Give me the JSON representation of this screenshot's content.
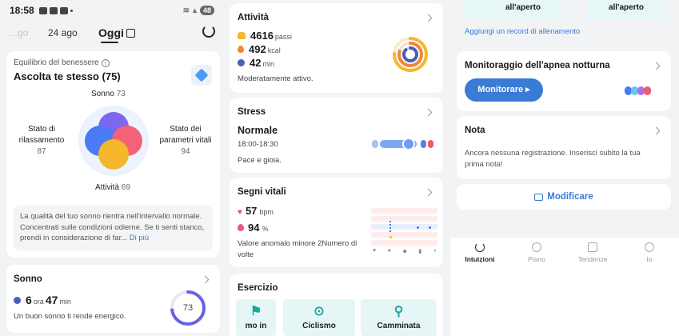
{
  "status_bar": {
    "time": "18:58",
    "battery": "48"
  },
  "date_nav": {
    "prev": "...go",
    "mid": "24 ago",
    "today": "Oggi"
  },
  "wellbeing": {
    "subtitle": "Equilibrio del benessere",
    "title": "Ascolta te stesso (75)",
    "sleep": {
      "label": "Sonno",
      "value": "73"
    },
    "relax": {
      "label": "Stato di rilassamento",
      "value": "87"
    },
    "vital": {
      "label": "Stato dei parametri vitali",
      "value": "94"
    },
    "activity": {
      "label": "Attività",
      "value": "69"
    },
    "advice": "La qualità del tuo sonno rientra nell'intervallo normale. Concentrati sulle condizioni odierne. Se ti senti stanco, prendi in considerazione di far...",
    "more_link": "Di più",
    "colors": {
      "sleep": "#7b68ee",
      "relax": "#4a7af4",
      "vital": "#f46277",
      "activity": "#f5b72c"
    }
  },
  "sleep_card": {
    "title": "Sonno",
    "hours": "6",
    "hours_unit": "ora",
    "minutes": "47",
    "minutes_unit": "min",
    "message": "Un buon sonno ti rende energico.",
    "score": "73",
    "score_fraction": 0.73
  },
  "activity_card": {
    "title": "Attività",
    "steps": "4616",
    "steps_unit": "passi",
    "kcal": "492",
    "kcal_unit": "kcal",
    "minutes": "42",
    "minutes_unit": "min",
    "status": "Moderatamente attivo."
  },
  "stress_card": {
    "title": "Stress",
    "value": "Normale",
    "time_range": "18:00-18:30",
    "note": "Pace e gioia."
  },
  "vitals_card": {
    "title": "Segni vitali",
    "heart_rate": "57",
    "heart_unit": "bpm",
    "spo2": "94",
    "spo2_unit": "%",
    "note": "Valore anomalo minore 2Numero di volte"
  },
  "exercise_card": {
    "title": "Esercizio",
    "tiles": [
      "mo in",
      "Ciclismo",
      "Camminata"
    ]
  },
  "outdoor_tiles": [
    "all'aperto",
    "all'aperto"
  ],
  "add_record": "Aggiungi un record di allenamento",
  "apnea_card": {
    "title": "Monitoraggio dell'apnea notturna",
    "button": "Monitorare ▸"
  },
  "note_card": {
    "title": "Nota",
    "text": "Ancora nessuna registrazione. Inserisci subito la tua prima nota!"
  },
  "edit_button": "Modificare",
  "tabs": [
    "Intuizioni",
    "Piano",
    "Tendenze",
    "Io"
  ],
  "accent": "#3a7bd5"
}
